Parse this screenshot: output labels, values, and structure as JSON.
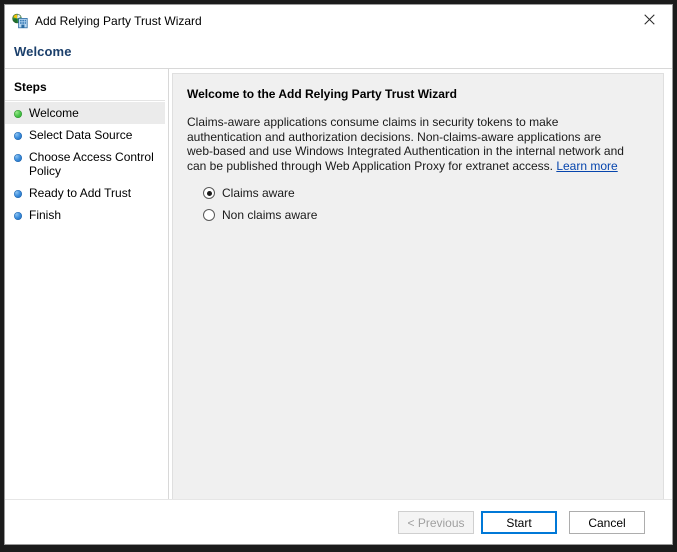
{
  "window": {
    "title": "Add Relying Party Trust Wizard",
    "icon": "adfs-wizard-icon",
    "close_label": "✕"
  },
  "header": {
    "page_title": "Welcome"
  },
  "sidebar": {
    "heading": "Steps",
    "items": [
      {
        "label": "Welcome",
        "state": "current",
        "bullet": "green"
      },
      {
        "label": "Select Data Source",
        "state": "pending",
        "bullet": "blue"
      },
      {
        "label": "Choose Access Control Policy",
        "state": "pending",
        "bullet": "blue"
      },
      {
        "label": "Ready to Add Trust",
        "state": "pending",
        "bullet": "blue"
      },
      {
        "label": "Finish",
        "state": "pending",
        "bullet": "blue"
      }
    ]
  },
  "content": {
    "heading": "Welcome to the Add Relying Party Trust Wizard",
    "body_before_link": "Claims-aware applications consume claims in security tokens to make authentication and authorization decisions. Non-claims-aware applications are web-based and use Windows Integrated Authentication in the internal network and can be published through Web Application Proxy for extranet access. ",
    "link_label": "Learn more",
    "options": [
      {
        "label": "Claims aware",
        "selected": true
      },
      {
        "label": "Non claims aware",
        "selected": false
      }
    ]
  },
  "footer": {
    "previous_label": "< Previous",
    "start_label": "Start",
    "cancel_label": "Cancel"
  },
  "colors": {
    "accent": "#0078d7",
    "title_blue": "#1b3f6b",
    "link": "#0645ad",
    "bullet_active": "#3fbf3f",
    "bullet_pending": "#2a7fd4",
    "panel_bg": "#f0f0f0",
    "desktop": "#1b1b1b"
  }
}
